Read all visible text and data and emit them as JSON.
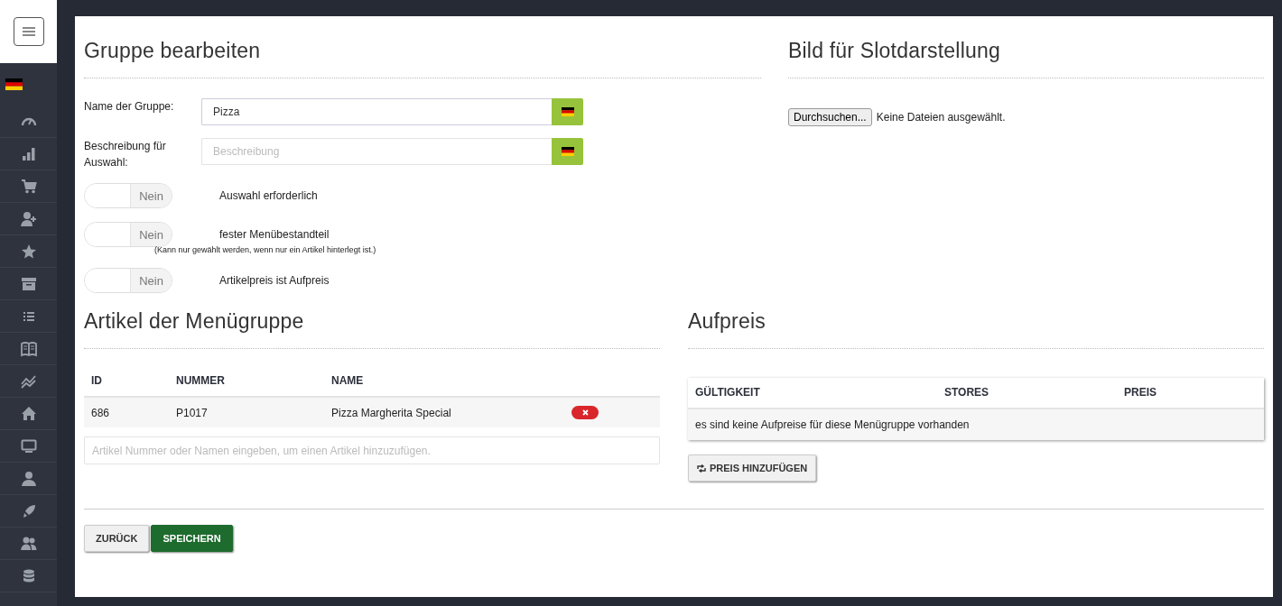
{
  "sidebar": {
    "items": [
      {
        "kind": "gauge"
      },
      {
        "kind": "bars"
      },
      {
        "kind": "cart"
      },
      {
        "kind": "user-plus"
      },
      {
        "kind": "star"
      },
      {
        "kind": "archive"
      },
      {
        "kind": "list"
      },
      {
        "kind": "book"
      },
      {
        "kind": "trend"
      },
      {
        "kind": "home"
      },
      {
        "kind": "monitor"
      },
      {
        "kind": "user"
      },
      {
        "kind": "rocket"
      },
      {
        "kind": "users"
      },
      {
        "kind": "database"
      }
    ]
  },
  "group_edit": {
    "title": "Gruppe bearbeiten",
    "fields": [
      {
        "label": "Name der Gruppe:",
        "value": "Pizza"
      },
      {
        "label": "Beschreibung für Auswahl:",
        "placeholder": "Beschreibung"
      }
    ],
    "toggles": [
      {
        "label": "Auswahl erforderlich",
        "on": false,
        "state_text": "Nein"
      },
      {
        "label": "fester Menübestandteil",
        "note": "(Kann nur gewählt werden, wenn nur ein Artikel hinterlegt ist.)",
        "on": false,
        "state_text": "Nein"
      },
      {
        "label": "Artikelpreis ist Aufpreis",
        "on": false,
        "state_text": "Nein"
      }
    ]
  },
  "image": {
    "title": "Bild für Slotdarstellung",
    "browse_button": "Durchsuchen...",
    "file_status": "Keine Dateien ausgewählt."
  },
  "articles": {
    "title": "Artikel der Menügruppe",
    "columns": [
      "ID",
      "NUMMER",
      "NAME"
    ],
    "rows": [
      {
        "cells": [
          "686",
          "P1017",
          "Pizza Margherita Special"
        ]
      }
    ],
    "search": {
      "placeholder": "Artikel Nummer oder Namen eingeben, um einen Artikel hinzuzufügen."
    }
  },
  "surcharge": {
    "title": "Aufpreis",
    "columns": [
      "GÜLTIGKEIT",
      "STORES",
      "PREIS"
    ],
    "empty_message": "es sind keine Aufpreise für diese Menügruppe vorhanden",
    "add_button": "PREIS HINZUFÜGEN"
  },
  "footer": {
    "buttons": [
      {
        "label": "ZURÜCK",
        "kind": "default"
      },
      {
        "label": "SPEICHERN",
        "kind": "primary"
      }
    ]
  }
}
